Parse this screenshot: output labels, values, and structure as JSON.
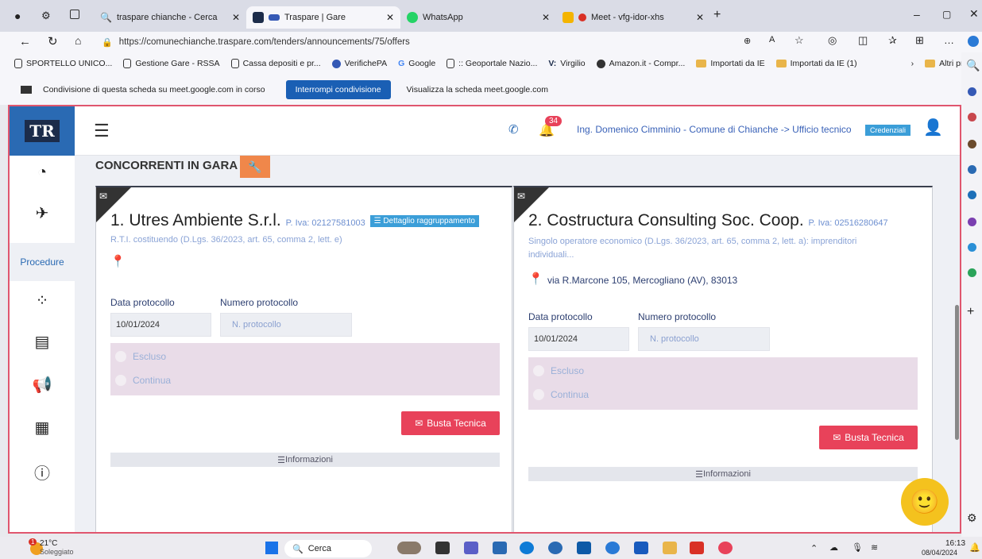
{
  "browser": {
    "tabs": [
      {
        "label": "traspare chianche - Cerca",
        "active": false
      },
      {
        "label": "Traspare | Gare",
        "active": true
      },
      {
        "label": "WhatsApp",
        "active": false
      },
      {
        "label": "Meet - vfg-idor-xhs",
        "active": false
      }
    ],
    "new_tab": "+",
    "url": "https://comunechianche.traspare.com/tenders/announcements/75/offers",
    "bookmarks": [
      "SPORTELLO UNICO...",
      "Gestione Gare - RSSA",
      "Cassa depositi e pr...",
      "VerifichePA",
      "Google",
      ":: Geoportale Nazio...",
      "Virgilio",
      "Amazon.it - Compr...",
      "Importati da IE",
      "Importati da IE (1)"
    ],
    "other_favorites": "Altri preferiti",
    "share_bar": {
      "message": "Condivisione di questa scheda su meet.google.com in corso",
      "stop_button": "Interrompi condivisione",
      "view_button": "Visualizza la scheda meet.google.com"
    }
  },
  "app": {
    "logo": "TR",
    "notifications": "34",
    "user": "Ing. Domenico Cimminio - Comune di Chianche -> Ufficio tecnico",
    "credentials_button": "Credenziali",
    "sidebar": {
      "procedure_label": "Procedure"
    },
    "page_title": "CONCORRENTI IN GARA",
    "cards": [
      {
        "title": "1. Utres Ambiente S.r.l.",
        "piva": "P. Iva: 02127581003",
        "group_button": "Dettaglio raggruppamento",
        "subtitle": "R.T.I. costituendo (D.Lgs. 36/2023, art. 65, comma 2, lett. e)",
        "address": "",
        "date_label": "Data protocollo",
        "number_label": "Numero protocollo",
        "date_value": "10/01/2024",
        "number_placeholder": "N. protocollo",
        "excluded": "Escluso",
        "continue": "Continua",
        "busta": "Busta Tecnica",
        "info": "Informazioni"
      },
      {
        "title": "2. Costructura Consulting Soc. Coop.",
        "piva": "P. Iva: 02516280647",
        "subtitle": "Singolo operatore economico (D.Lgs. 36/2023, art. 65, comma 2, lett. a): imprenditori individuali...",
        "address": "via R.Marcone 105, Mercogliano (AV), 83013",
        "date_label": "Data protocollo",
        "number_label": "Numero protocollo",
        "date_value": "10/01/2024",
        "number_placeholder": "N. protocollo",
        "excluded": "Escluso",
        "continue": "Continua",
        "busta": "Busta Tecnica",
        "info": "Informazioni"
      }
    ]
  },
  "taskbar": {
    "weather_temp": "21°C",
    "weather_desc": "Soleggiato",
    "weather_badge": "1",
    "search": "Cerca",
    "time": "16:13",
    "date": "08/04/2024"
  },
  "colors": {
    "accent": "#2a6ab3",
    "danger": "#e8425a",
    "wrench": "#f0874a",
    "highlight_border": "#e0566e"
  }
}
